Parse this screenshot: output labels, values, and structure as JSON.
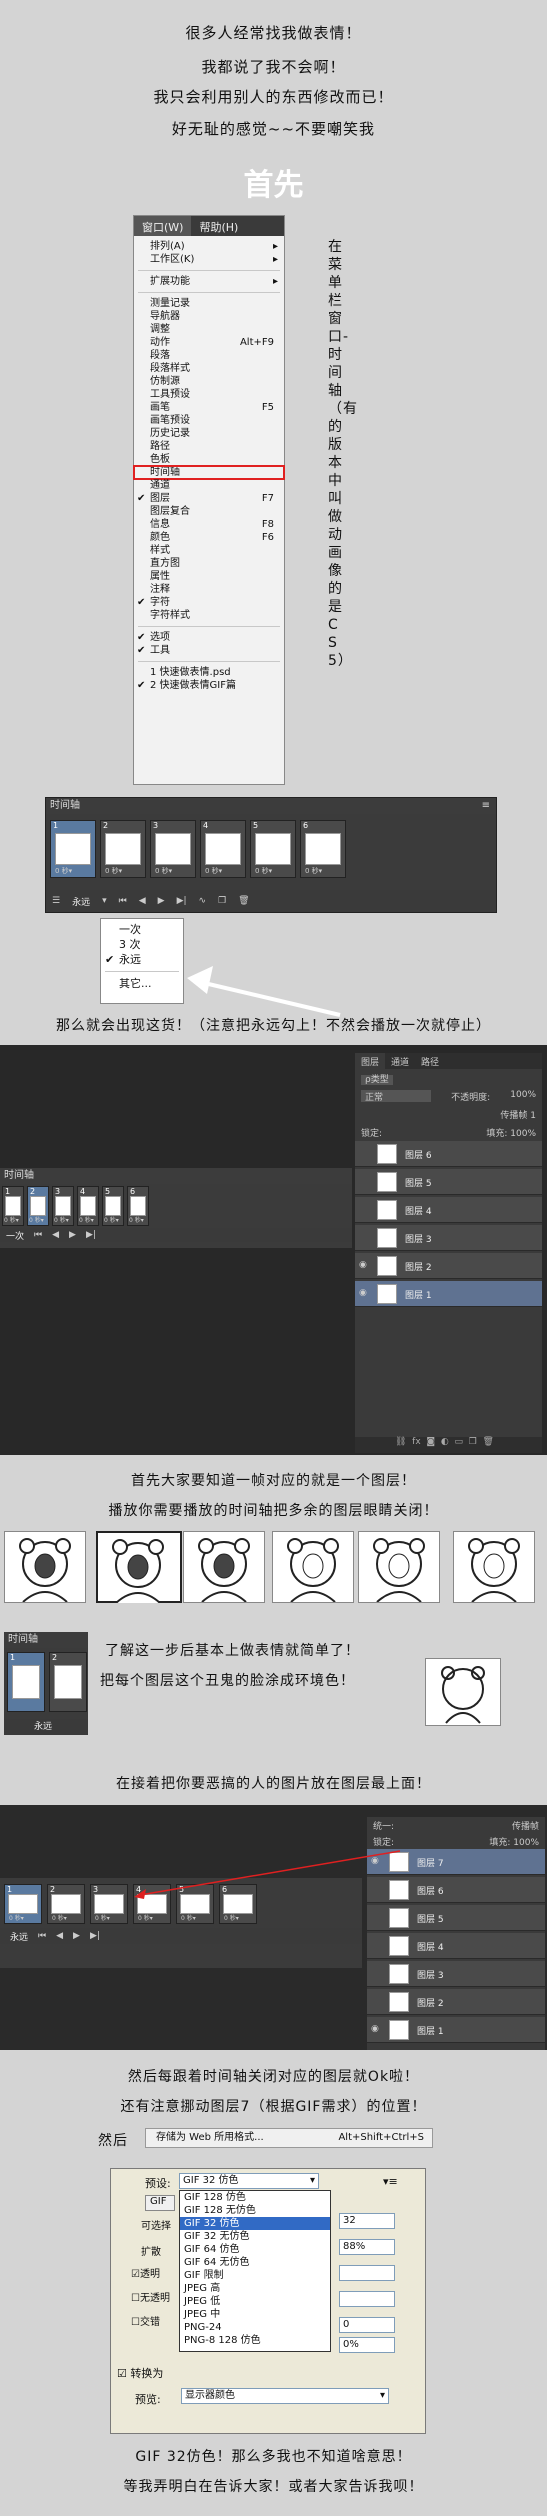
{
  "intro": {
    "lines": [
      "很多人经常找我做表情！",
      "我都说了我不会啊！",
      "我只会利用别人的东西修改而已！",
      "好无耻的感觉~~不要嘲笑我"
    ],
    "heading": "首先"
  },
  "menu": {
    "bar": [
      "窗口(W)",
      "帮助(H)"
    ],
    "groups": [
      [
        {
          "label": "排列(A)",
          "arrow": "▸"
        },
        {
          "label": "工作区(K)",
          "arrow": "▸"
        }
      ],
      [
        {
          "label": "扩展功能",
          "arrow": "▸"
        }
      ],
      [
        {
          "label": "测量记录"
        },
        {
          "label": "导航器"
        },
        {
          "label": "调整"
        },
        {
          "label": "动作",
          "shortcut": "Alt+F9"
        },
        {
          "label": "段落"
        },
        {
          "label": "段落样式"
        },
        {
          "label": "仿制源"
        },
        {
          "label": "工具预设"
        },
        {
          "label": "画笔",
          "shortcut": "F5"
        },
        {
          "label": "画笔预设"
        },
        {
          "label": "历史记录"
        },
        {
          "label": "路径"
        },
        {
          "label": "色板"
        },
        {
          "label": "时间轴",
          "highlight": true
        },
        {
          "label": "通道"
        },
        {
          "label": "图层",
          "shortcut": "F7",
          "checked": "✔"
        },
        {
          "label": "图层复合"
        },
        {
          "label": "信息",
          "shortcut": "F8"
        },
        {
          "label": "颜色",
          "shortcut": "F6"
        },
        {
          "label": "样式"
        },
        {
          "label": "直方图"
        },
        {
          "label": "属性"
        },
        {
          "label": "注释"
        },
        {
          "label": "字符",
          "checked": "✔"
        },
        {
          "label": "字符样式"
        }
      ],
      [
        {
          "label": "选项",
          "checked": "✔"
        },
        {
          "label": "工具",
          "checked": "✔"
        }
      ],
      [
        {
          "label": "1 快速做表情.psd"
        },
        {
          "label": "2 快速做表情GIF篇",
          "checked": "✔"
        }
      ]
    ],
    "vertical_note": "在菜单栏 窗口-时间轴（有的版本中叫做动画像的是CS5）"
  },
  "timeline1": {
    "title": "时间轴",
    "frames": [
      {
        "num": "1",
        "dur": "0 秒▾"
      },
      {
        "num": "2",
        "dur": "0 秒▾"
      },
      {
        "num": "3",
        "dur": "0 秒▾"
      },
      {
        "num": "4",
        "dur": "0 秒▾"
      },
      {
        "num": "5",
        "dur": "0 秒▾"
      },
      {
        "num": "6",
        "dur": "0 秒▾"
      }
    ],
    "loop_value": "永远",
    "loop_options": [
      {
        "label": "一次"
      },
      {
        "label": "3 次"
      },
      {
        "label": "永远",
        "checked": "✔"
      },
      {
        "label": "其它..."
      }
    ]
  },
  "note1": "那么就会出现这货！（注意把永远勾上！不然会播放一次就停止）",
  "ps_window": {
    "layers_tabs": [
      "图层",
      "通道",
      "路径"
    ],
    "kind_label": "ρ类型",
    "blend": "正常",
    "opacity_label": "不透明度:",
    "opacity": "100%",
    "lock_label": "锁定:",
    "fill_label": "填充:",
    "fill": "100%",
    "propagate": "传播帧 1",
    "layers": [
      "图层 6",
      "图层 5",
      "图层 4",
      "图层 3",
      "图层 2",
      "图层 1"
    ],
    "timeline_title": "时间轴",
    "frames": [
      "1",
      "2",
      "3",
      "4",
      "5",
      "6"
    ],
    "frame_dur": "0 秒▾",
    "loop": "一次"
  },
  "note2": [
    "首先大家要知道一帧对应的就是一个图层！",
    "播放你需要播放的时间轴把多余的图层眼睛关闭！"
  ],
  "note3": [
    "了解这一步后基本上做表情就简单了！",
    "把每个图层这个丑鬼的脸涂成环境色！"
  ],
  "mini_timeline": {
    "title": "时间轴",
    "loop": "永远",
    "frames": [
      "1",
      "2"
    ]
  },
  "note4": "在接着把你要恶搞的人的图片放在图层最上面！",
  "ps_window2": {
    "lock_label": "锁定:",
    "fill_label": "填充:",
    "fill": "100%",
    "unify_label": "统一:",
    "propagate": "传播帧",
    "layers": [
      "图层 7",
      "图层 6",
      "图层 5",
      "图层 4",
      "图层 3",
      "图层 2",
      "图层 1"
    ],
    "frames": [
      "1",
      "2",
      "3",
      "4",
      "5",
      "6"
    ],
    "frame_dur": "0 秒▾",
    "loop": "永远"
  },
  "note5": [
    "然后每跟着时间轴关闭对应的图层就Ok啦！",
    "还有注意挪动图层7（根据GIF需求）的位置！"
  ],
  "save_row": {
    "prefix": "然后",
    "command": "存储为 Web 所用格式...",
    "shortcut": "Alt+Shift+Ctrl+S"
  },
  "sfw": {
    "preset_label": "预设:",
    "preset_value": "GIF 32 仿色",
    "gif_label": "GIF",
    "options": [
      {
        "label": "GIF 128 仿色"
      },
      {
        "label": "GIF 128 无仿色"
      },
      {
        "label": "GIF 32 仿色",
        "selected": true
      },
      {
        "label": "GIF 32 无仿色"
      },
      {
        "label": "GIF 64 仿色"
      },
      {
        "label": "GIF 64 无仿色"
      },
      {
        "label": "GIF 限制"
      },
      {
        "label": "JPEG 高"
      },
      {
        "label": "JPEG 低"
      },
      {
        "label": "JPEG 中"
      },
      {
        "label": "PNG-24"
      },
      {
        "label": "PNG-8 128 仿色"
      }
    ],
    "left_labels": [
      "可选择",
      "扩散",
      "透明",
      "无透明",
      "交错"
    ],
    "colors_value": "32",
    "dither_value": "88%",
    "lossy_value": "0",
    "web_snap_value": "0%",
    "convert_label": "转换为",
    "preview_label": "预览:",
    "preview_value": "显示器颜色",
    "menu_glyph": "▾≡"
  },
  "outro": [
    "GIF 32仿色！那么多我也不知道啥意思！",
    "等我弄明白在告诉大家！或者大家告诉我呗！"
  ]
}
